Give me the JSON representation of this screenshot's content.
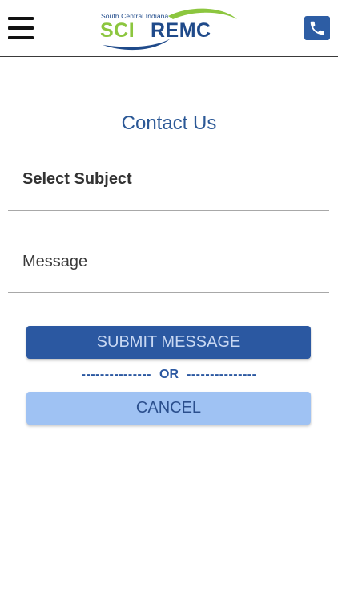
{
  "header": {
    "menu_icon": "hamburger-menu-icon",
    "phone_icon": "phone-icon",
    "logo": {
      "tagline": "South Central Indiana",
      "name_part1": "SCI",
      "name_part2": "REMC"
    },
    "colors": {
      "brand_blue": "#1f4a8a",
      "brand_green": "#8cc63f",
      "phone_button": "#2d5da4"
    }
  },
  "main": {
    "title": "Contact Us",
    "subject_field": {
      "label": "Select Subject"
    },
    "message_field": {
      "placeholder": "Message"
    },
    "submit_label": "SUBMIT MESSAGE",
    "divider": {
      "left": "---------------",
      "label": "OR",
      "right": "---------------"
    },
    "cancel_label": "CANCEL"
  },
  "colors": {
    "title_text": "#2b5896",
    "submit_bg": "#2b58a1",
    "cancel_bg": "#9fc2f3"
  }
}
